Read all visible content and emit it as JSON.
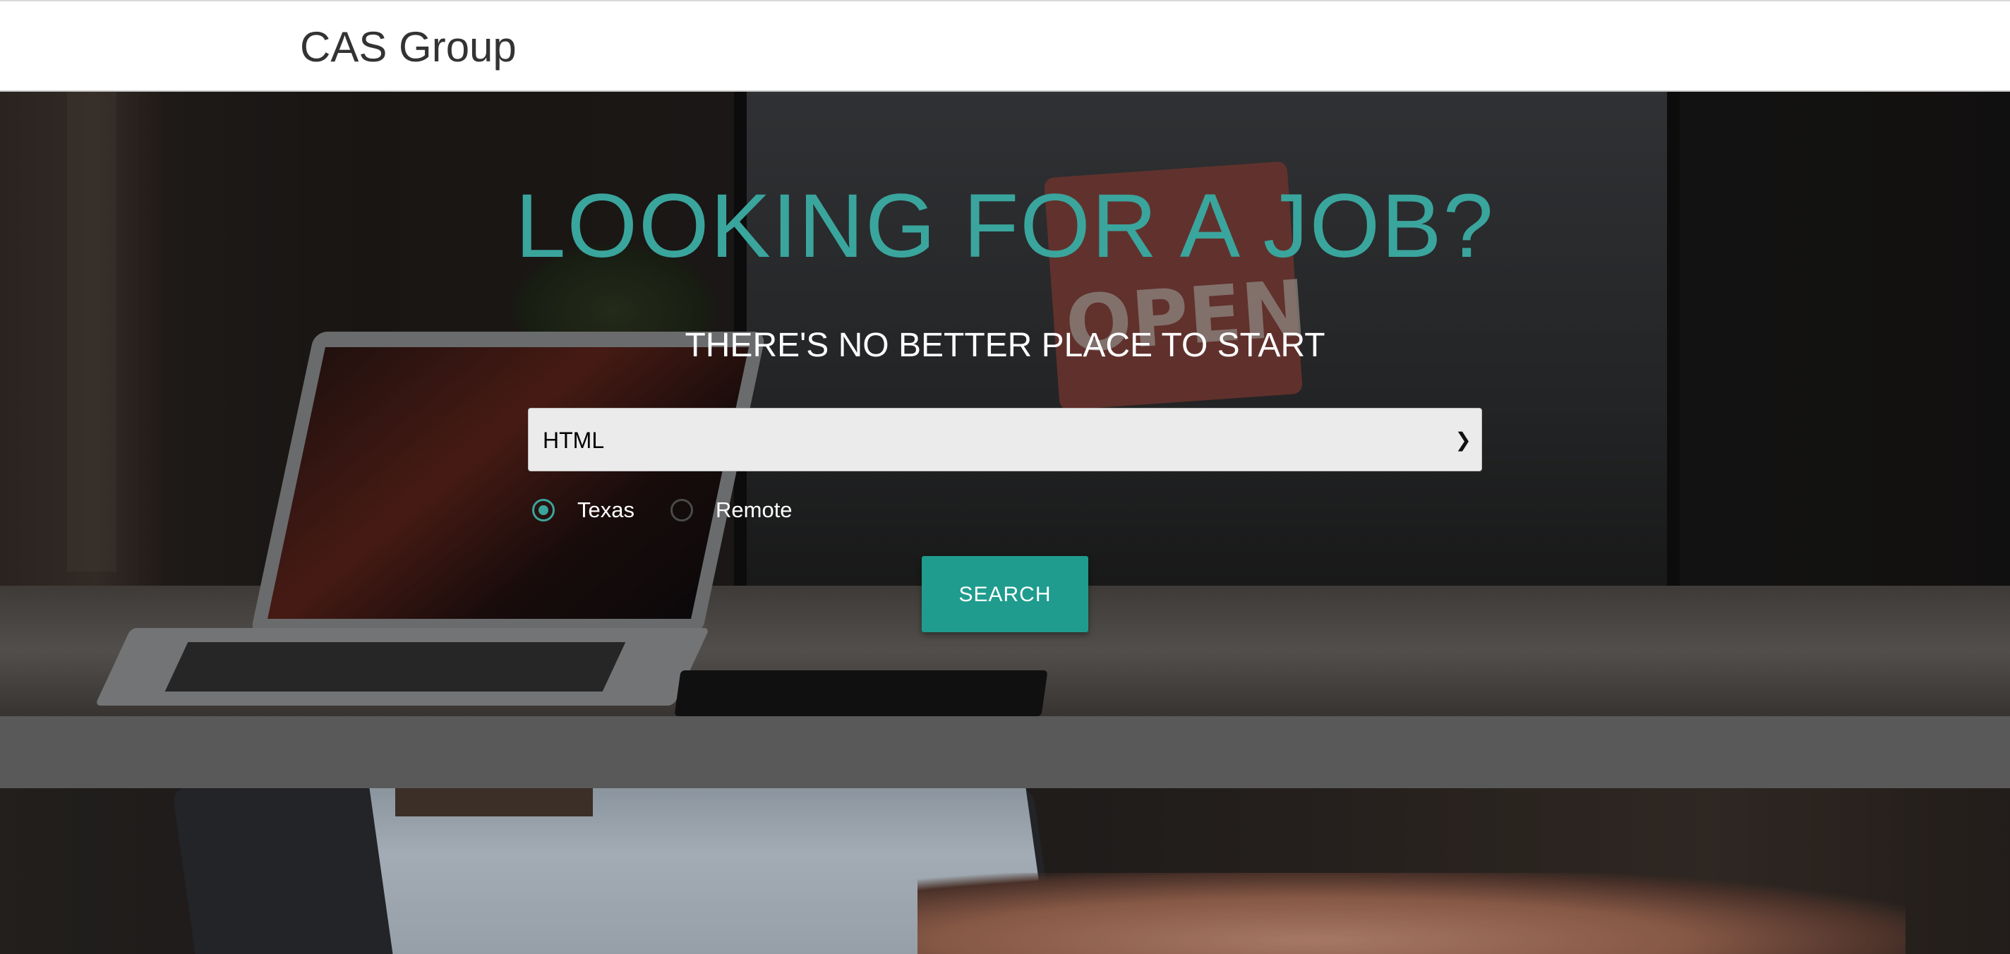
{
  "navbar": {
    "brand": "CAS Group"
  },
  "hero": {
    "title": "LOOKING FOR A JOB?",
    "subtitle": "THERE'S NO BETTER PLACE TO START",
    "select": {
      "selected": "HTML"
    },
    "location_options": [
      {
        "label": "Texas",
        "checked": true
      },
      {
        "label": "Remote",
        "checked": false
      }
    ],
    "search_label": "SEARCH"
  },
  "colors": {
    "accent": "#3aa59d",
    "button": "#1f9c8e",
    "band": "#595959"
  }
}
